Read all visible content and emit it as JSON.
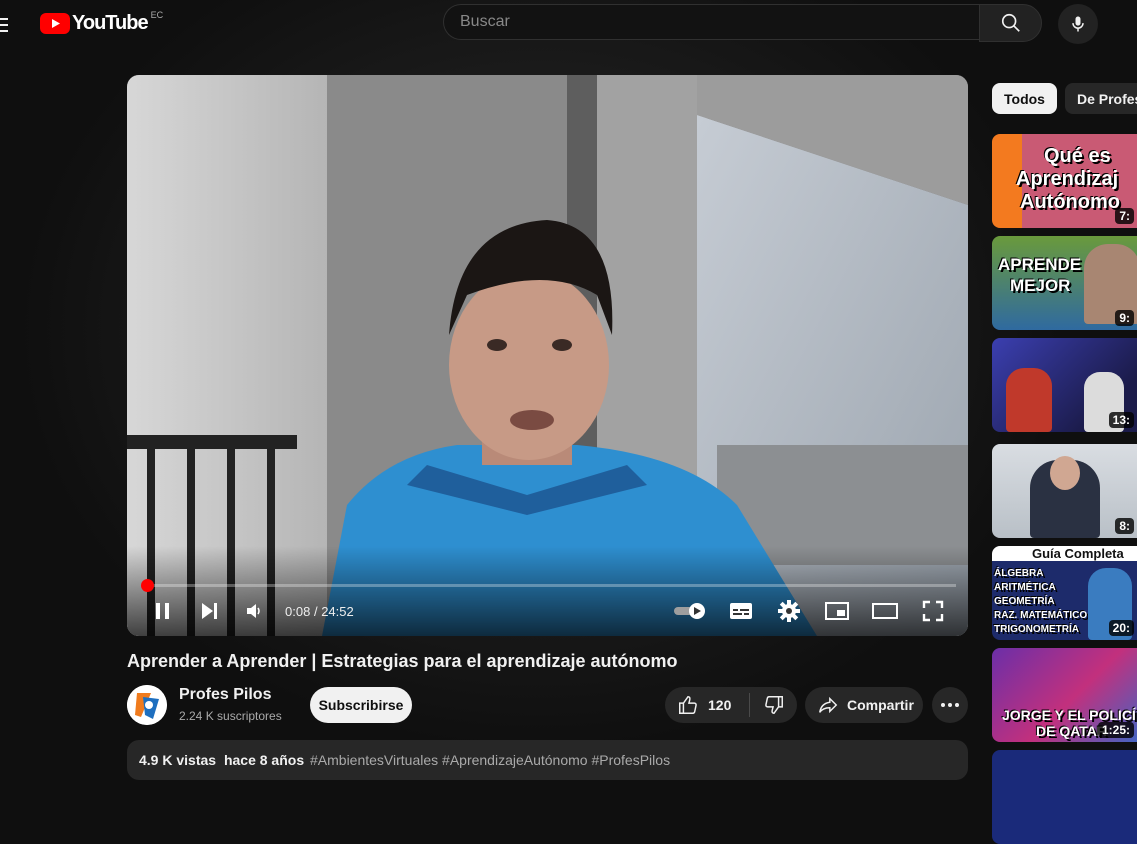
{
  "header": {
    "logo_text": "YouTube",
    "region": "EC",
    "search_placeholder": "Buscar"
  },
  "player": {
    "time_current": "0:08",
    "time_separator": "/",
    "time_total": "24:52",
    "progress_fraction": 0.005
  },
  "video": {
    "title": "Aprender a Aprender | Estrategias para el aprendizaje autónomo",
    "channel_name": "Profes Pilos",
    "subscribers": "2.24 K suscriptores",
    "subscribe_label": "Subscribirse",
    "likes": "120",
    "share_label": "Compartir",
    "views": "4.9 K vistas",
    "posted": "hace 8 años",
    "hashtags": "#AmbientesVirtuales #AprendizajeAutónomo #ProfesPilos"
  },
  "sidebar": {
    "chips": [
      "Todos",
      "De Profes"
    ],
    "videos": [
      {
        "thumb_lines": [
          "Qué es",
          "Aprendizaj",
          "Autónomo"
        ],
        "duration": "7:"
      },
      {
        "thumb_lines": [
          "APRENDE",
          "MEJOR"
        ],
        "duration": "9:"
      },
      {
        "thumb_lines": [],
        "duration": "13:"
      },
      {
        "thumb_lines": [],
        "duration": "8:"
      },
      {
        "thumb_lines": [
          "Guía Completa",
          "ÁLGEBRA",
          "ARITMÉTICA",
          "GEOMETRÍA",
          "RAZ. MATEMÁTICO",
          "TRIGONOMETRÍA"
        ],
        "duration": "20:"
      },
      {
        "thumb_lines": [
          "JORGE Y EL POLICÍ",
          "DE QATAR"
        ],
        "duration": "1:25:"
      }
    ]
  },
  "colors": {
    "background": "#0f0f0f",
    "accent_red": "#ff0000",
    "chip_active": "#f1f1f1",
    "button_bg": "#272727",
    "jersey_blue": "#2e8fd0"
  }
}
